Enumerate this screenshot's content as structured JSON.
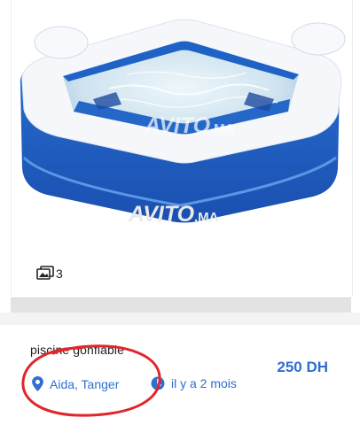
{
  "gallery": {
    "photo_count": "3",
    "watermark": "AVITO.MA"
  },
  "listing": {
    "title": "piscine gonflable",
    "price": "250 DH",
    "location": "Aida, Tanger",
    "posted": "il y a 2 mois"
  },
  "icons": {
    "photos": "photos-icon",
    "location": "location-pin-icon",
    "time": "clock-icon"
  },
  "colors": {
    "accent": "#2f6fcf",
    "pool_blue": "#1d5fc4",
    "annotation": "#e0262b"
  }
}
